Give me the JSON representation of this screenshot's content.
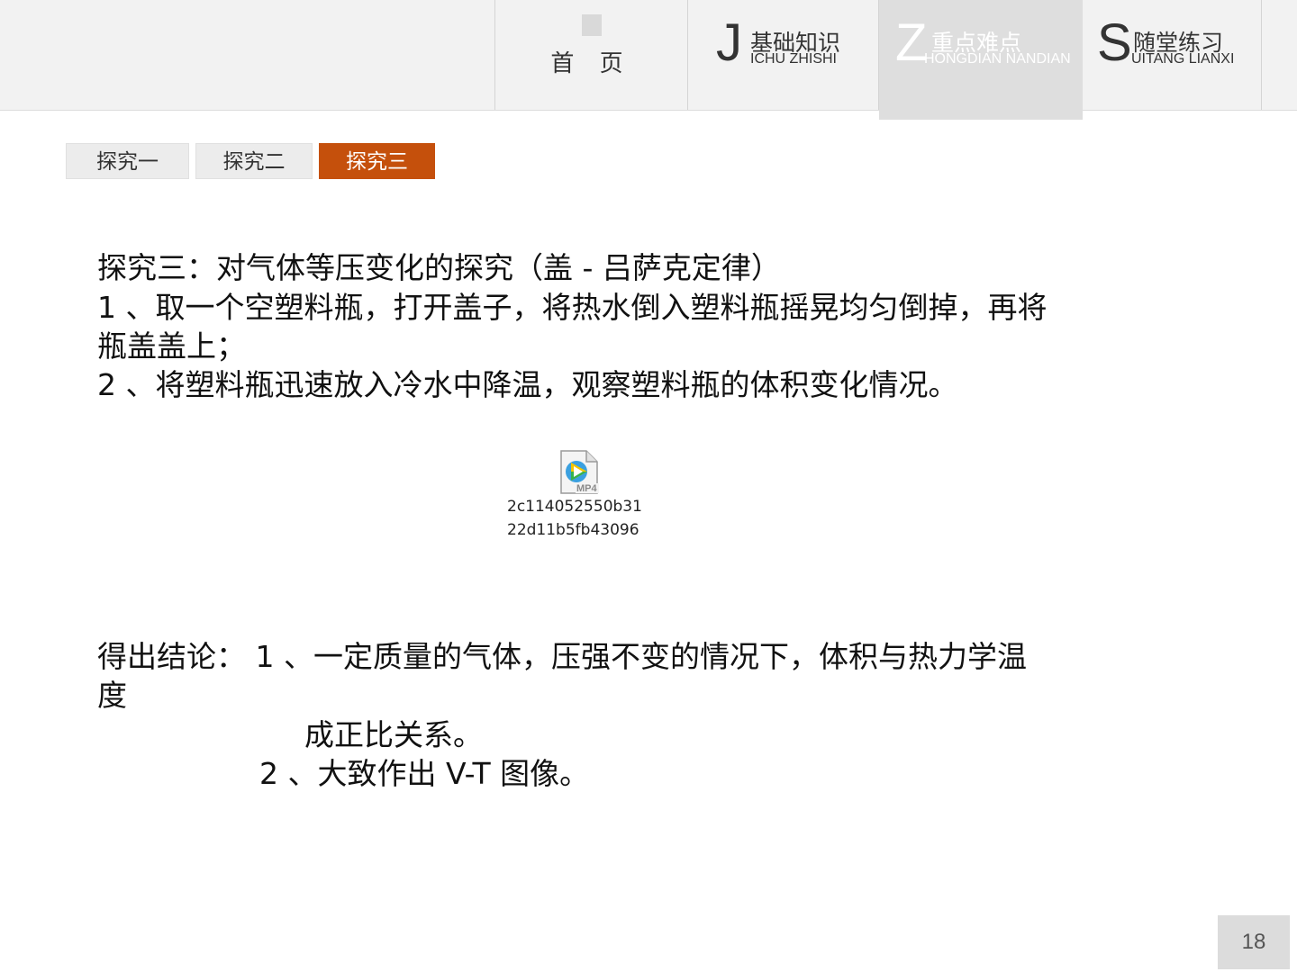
{
  "nav": {
    "home_label": "首 页",
    "tabs": [
      {
        "letter": "J",
        "cn": "基础知识",
        "en": "ICHU ZHISHI",
        "active": false
      },
      {
        "letter": "Z",
        "cn": "重点难点",
        "en": "HONGDIAN NANDIAN",
        "active": true
      },
      {
        "letter": "S",
        "cn": "随堂练习",
        "en": "UITANG LIANXI",
        "active": false
      }
    ]
  },
  "subtabs": [
    {
      "label": "探究一",
      "active": false
    },
    {
      "label": "探究二",
      "active": false
    },
    {
      "label": "探究三",
      "active": true
    }
  ],
  "content": {
    "title": "探究三：对气体等压变化的探究（盖 - 吕萨克定律）",
    "step1_line1": "1 、取一个空塑料瓶，打开盖子，将热水倒入塑料瓶摇晃均匀倒掉，再将",
    "step1_line2": "瓶盖盖上；",
    "step2": "2 、将塑料瓶迅速放入冷水中降温，观察塑料瓶的体积变化情况。",
    "media": {
      "icon": "mp4-video-file-icon",
      "badge": "MP4",
      "caption_line1": "2c114052550b31",
      "caption_line2": "22d11b5fb43096"
    },
    "conclusion_line1": "得出结论： 1 、一定质量的气体，压强不变的情况下，体积与热力学温",
    "conclusion_line2": "度",
    "conclusion_line3": "成正比关系。",
    "conclusion_line4": "2 、大致作出 V-T 图像。"
  },
  "page_number": "18",
  "colors": {
    "accent": "#c5500c",
    "bar_bg": "#f2f2f2",
    "active_tab_bg": "#dedede"
  }
}
